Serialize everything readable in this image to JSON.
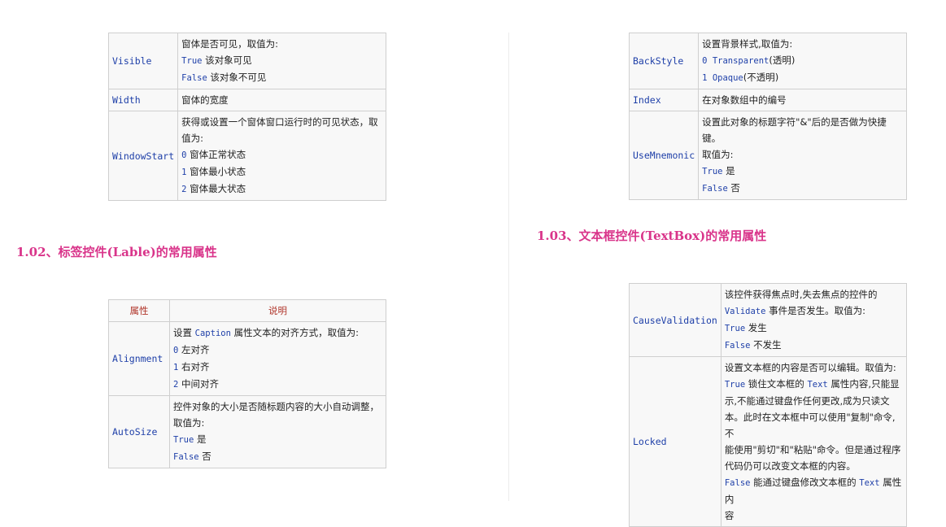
{
  "table1": {
    "rows": [
      {
        "name": "Visible",
        "lines": [
          {
            "text": "窗体是否可见，取值为:"
          },
          {
            "code": "True",
            "text": " 该对象可见"
          },
          {
            "code": "False",
            "text": " 该对象不可见"
          }
        ]
      },
      {
        "name": "Width",
        "lines": [
          {
            "text": "窗体的宽度"
          }
        ]
      },
      {
        "name": "WindowStart",
        "lines": [
          {
            "text": "获得或设置一个窗体窗口运行时的可见状态，取"
          },
          {
            "text": "值为:"
          },
          {
            "code": "0",
            "text": " 窗体正常状态"
          },
          {
            "code": "1",
            "text": " 窗体最小状态"
          },
          {
            "code": "2",
            "text": " 窗体最大状态"
          }
        ]
      }
    ]
  },
  "heading_label": "1.02、标签控件(Lable)的常用属性",
  "table2": {
    "header_prop": "属性",
    "header_desc": "说明",
    "rows": [
      {
        "name": "Alignment",
        "lines": [
          {
            "pre": "设置 ",
            "code": "Caption",
            "text": " 属性文本的对齐方式，取值为:"
          },
          {
            "code": "0",
            "text": " 左对齐"
          },
          {
            "code": "1",
            "text": " 右对齐"
          },
          {
            "code": "2",
            "text": " 中间对齐"
          }
        ]
      },
      {
        "name": "AutoSize",
        "lines": [
          {
            "text": "控件对象的大小是否随标题内容的大小自动调整，"
          },
          {
            "text": "取值为:"
          },
          {
            "code": "True",
            "text": " 是"
          },
          {
            "code": "False",
            "text": " 否"
          }
        ]
      }
    ]
  },
  "table3": {
    "rows": [
      {
        "name": "BackStyle",
        "lines": [
          {
            "text": "设置背景样式,取值为:"
          },
          {
            "code": "0 Transparent",
            "text": "(透明)"
          },
          {
            "code": "1 Opaque",
            "text": "(不透明)"
          }
        ]
      },
      {
        "name": "Index",
        "lines": [
          {
            "text": "在对象数组中的编号"
          }
        ]
      },
      {
        "name": "UseMnemonic",
        "lines": [
          {
            "text": "设置此对象的标题字符\"&\"后的是否做为快捷键。"
          },
          {
            "text": "取值为:"
          },
          {
            "code": "True",
            "text": " 是"
          },
          {
            "code": "False",
            "text": " 否"
          }
        ]
      }
    ]
  },
  "heading_textbox": "1.03、文本框控件(TextBox)的常用属性",
  "table4": {
    "rows": [
      {
        "name": "CauseValidation",
        "lines": [
          {
            "text": "该控件获得焦点时,失去焦点的控件的"
          },
          {
            "code": "Validate",
            "text": " 事件是否发生。取值为:"
          },
          {
            "code": "True",
            "text": " 发生"
          },
          {
            "code": "False",
            "text": " 不发生"
          }
        ]
      },
      {
        "name": "Locked",
        "lines": [
          {
            "text": "设置文本框的内容是否可以编辑。取值为:"
          },
          {
            "code": "True",
            "text": " 锁住文本框的 ",
            "code2": "Text",
            "text2": " 属性内容,只能显"
          },
          {
            "text": "示,不能通过键盘作任何更改,成为只读文"
          },
          {
            "text": "本。此时在文本框中可以使用\"复制\"命令,不"
          },
          {
            "text": "能使用\"剪切\"和\"粘贴\"命令。但是通过程序"
          },
          {
            "text": "代码仍可以改变文本框的内容。"
          },
          {
            "code": "False",
            "text": " 能通过键盘修改文本框的 ",
            "code2": "Text",
            "text2": " 属性内"
          },
          {
            "text": "容"
          }
        ]
      }
    ]
  }
}
